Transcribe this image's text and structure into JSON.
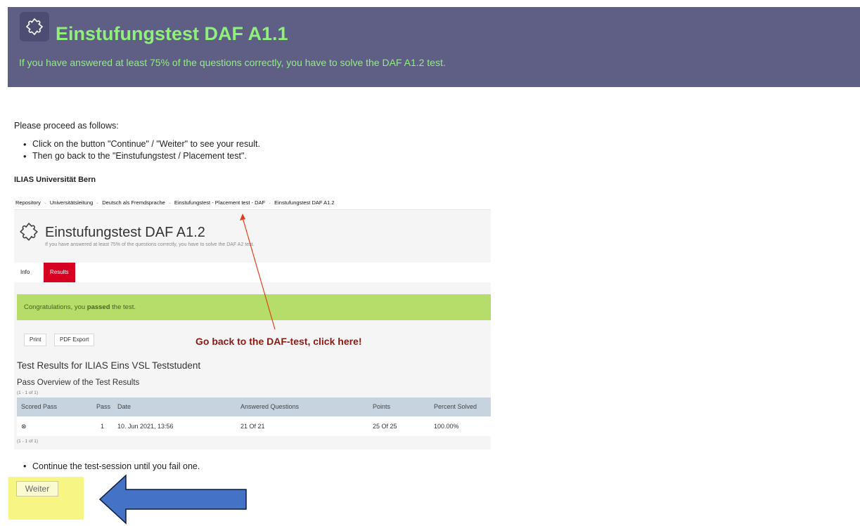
{
  "header": {
    "title": "Einstufungstest DAF A1.1",
    "subtitle": "If you have answered at least 75% of the questions correctly, you have to solve the DAF A1.2 test.",
    "icon": "puzzle-icon",
    "background": "#5f5f86",
    "accent": "#8ff07a"
  },
  "instructions": {
    "intro": "Please proceed as follows:",
    "steps": [
      "Click on the button \"Continue\" / \"Weiter\" to see your result.",
      "Then go back to the \"Einstufungstest / Placement test\"."
    ],
    "source_label": "ILIAS Universität Bern",
    "continue_step": "Continue the test-session until you fail one."
  },
  "screenshot": {
    "breadcrumbs": [
      "Repository",
      "Universitätsleitung",
      "Deutsch als Fremdsprache",
      "Einstufungstest - Placement test - DAF",
      "Einstufungstest DAF A1.2"
    ],
    "title": "Einstufungstest DAF A1.2",
    "description": "If you have answered at least 75% of the questions correctly, you have to solve the DAF A2 test.",
    "tabs": {
      "info": "Info",
      "results": "Results"
    },
    "success_prefix": "Congratulations, you ",
    "success_bold": "passed",
    "success_suffix": " the test.",
    "print_label": "Print",
    "pdf_label": "PDF Export",
    "annotation": "Go back to the DAF-test, click here!",
    "results_title": "Test Results for ILIAS Eins VSL Teststudent",
    "pass_overview": "Pass Overview of the Test Results",
    "range_top": "(1 - 1 of 1)",
    "range_bottom": "(1 - 1 of 1)",
    "table": {
      "headers": [
        "Scored Pass",
        "Pass",
        "Date",
        "Answered Questions",
        "Points",
        "Percent Solved"
      ],
      "row": [
        "⊗",
        "1",
        "10. Jun 2021, 13:56",
        "21 Of 21",
        "25 Of 25",
        "100.00%"
      ]
    }
  },
  "weiter_button": "Weiter",
  "colors": {
    "results_tab": "#d70020",
    "success_bar": "#b6dd6a",
    "annotation": "#8b1a12",
    "highlight": "#f4f25a",
    "arrow_fill": "#4472c4",
    "arrow_stroke": "#0d1a3a",
    "pointer_line": "#e0411c"
  }
}
